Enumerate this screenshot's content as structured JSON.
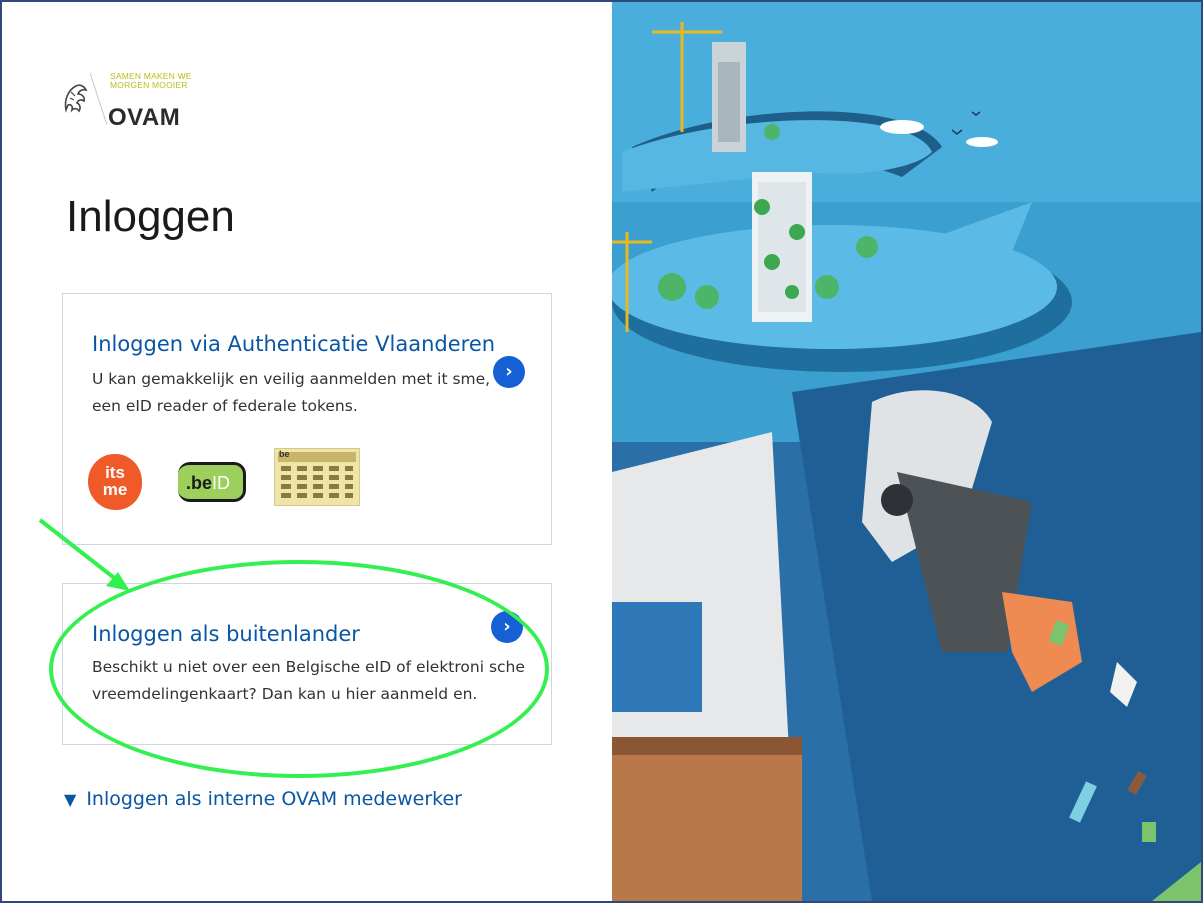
{
  "logo": {
    "slogan_line1": "SAMEN MAKEN WE",
    "slogan_line2": "MORGEN MOOIER",
    "name": "OVAM"
  },
  "page": {
    "title": "Inloggen"
  },
  "card_auth": {
    "title": "Inloggen via Authenticatie Vlaanderen",
    "description": "U kan gemakkelijk en veilig aanmelden met it sme, een eID reader of federale tokens.",
    "arrow": "›",
    "badges": {
      "itsme_line1": "its",
      "itsme_line2": "me",
      "beid_prefix": ".be",
      "beid_suffix": "ID",
      "card_tag": "be"
    }
  },
  "card_foreign": {
    "title": "Inloggen als buitenlander",
    "description": "Beschikt u niet over een Belgische eID of elektroni sche vreemdelingenkaart? Dan kan u hier aanmeld en.",
    "arrow": "›"
  },
  "internal_link": {
    "marker": "▼",
    "label": "Inloggen als interne OVAM medewerker"
  },
  "colors": {
    "link_blue": "#0b56a4",
    "button_blue": "#1560d4",
    "annotation_green": "#33f050",
    "brand_lime": "#b7bf18"
  }
}
